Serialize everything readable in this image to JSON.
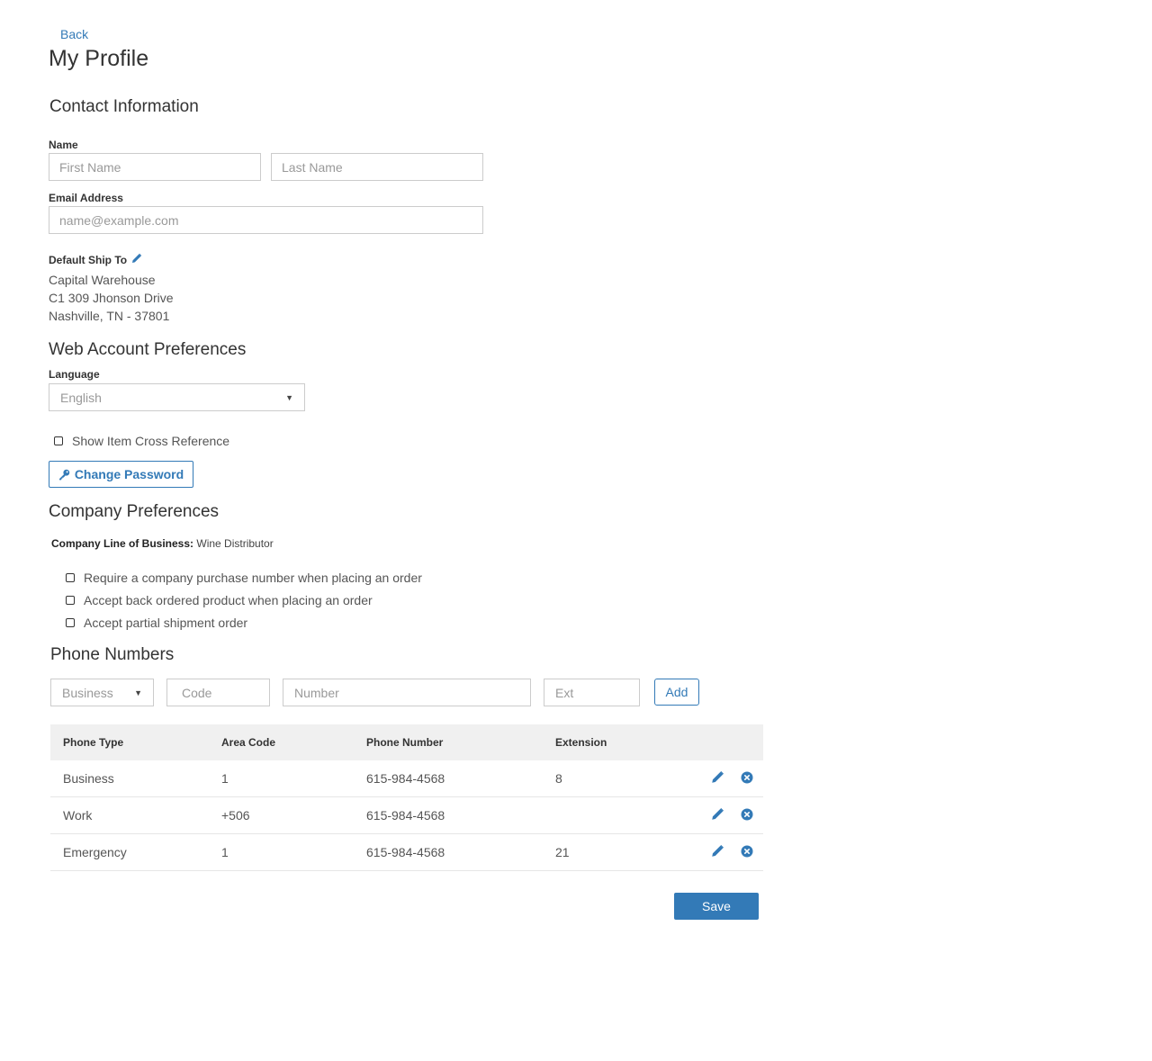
{
  "header": {
    "back_label": "Back",
    "page_title": "My Profile"
  },
  "contact": {
    "heading": "Contact Information",
    "name_label": "Name",
    "first_name_placeholder": "First Name",
    "last_name_placeholder": "Last Name",
    "email_label": "Email Address",
    "email_placeholder": "name@example.com",
    "ship_to_label": "Default Ship To",
    "ship_to_lines": [
      "Capital Warehouse",
      "C1 309 Jhonson Drive",
      "Nashville, TN - 37801"
    ]
  },
  "web_prefs": {
    "heading": "Web Account Preferences",
    "language_label": "Language",
    "language_value": "English",
    "cross_ref_label": "Show Item Cross Reference",
    "change_password_label": "Change Password"
  },
  "company_prefs": {
    "heading": "Company Preferences",
    "lob_label": "Company Line of Business:",
    "lob_value": "Wine Distributor",
    "options": [
      "Require a company purchase number when placing an order",
      "Accept back ordered product when placing an order",
      "Accept partial shipment order"
    ]
  },
  "phones": {
    "heading": "Phone Numbers",
    "type_value": "Business",
    "code_placeholder": "Code",
    "number_placeholder": "Number",
    "ext_placeholder": "Ext",
    "add_label": "Add",
    "columns": [
      "Phone Type",
      "Area Code",
      "Phone Number",
      "Extension"
    ],
    "rows": [
      {
        "type": "Business",
        "area": "1",
        "number": "615-984-4568",
        "ext": "8"
      },
      {
        "type": "Work",
        "area": "+506",
        "number": "615-984-4568",
        "ext": ""
      },
      {
        "type": "Emergency",
        "area": "1",
        "number": "615-984-4568",
        "ext": "21"
      }
    ]
  },
  "footer": {
    "save_label": "Save"
  },
  "colors": {
    "accent": "#337ab7",
    "table_header_bg": "#f0f0f0"
  },
  "icons": {
    "edit": "pencil-icon",
    "delete": "close-circle-icon",
    "key": "key-icon",
    "dropdown": "caret-down-icon"
  }
}
